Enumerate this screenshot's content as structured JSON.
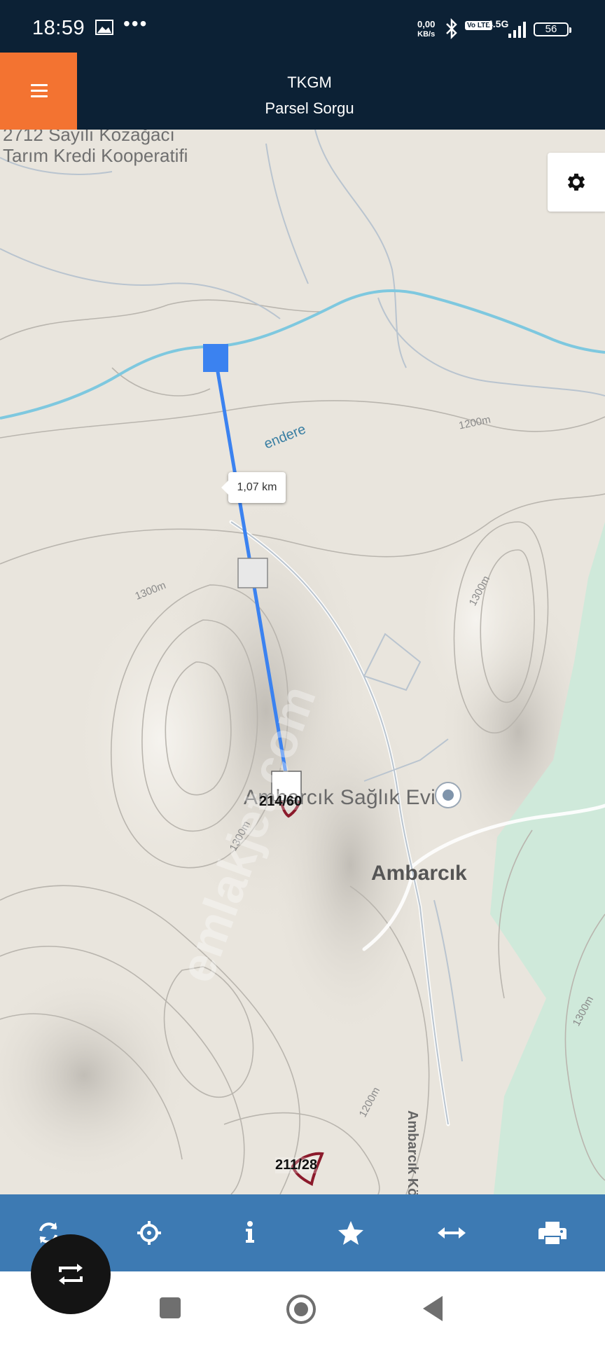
{
  "status_bar": {
    "time": "18:59",
    "dots": "•••",
    "net_speed_value": "0,00",
    "net_speed_unit": "KB/s",
    "volte": "Vo LTE",
    "network": "4.5G",
    "battery": "56"
  },
  "header": {
    "title": "TKGM",
    "subtitle": "Parsel Sorgu",
    "menu_icon": "hamburger-icon"
  },
  "map": {
    "place_labels": {
      "cooperative_line1": "2712 Sayılı Kozağacı",
      "cooperative_line2": "Tarım Kredi Kooperatifi",
      "stream": "endere",
      "health_post": "Ambarcık Sağlık Evi",
      "village": "Ambarcık",
      "road": "Ambarcık Köyü Yolu"
    },
    "contour_labels": [
      "1200m",
      "1300m",
      "1300m",
      "1300m",
      "1200m",
      "1300m"
    ],
    "measurement": {
      "distance": "1,07 km"
    },
    "parcels": [
      "214/60",
      "211/28"
    ],
    "watermark": "emlakjet.com",
    "settings_icon": "gear-icon",
    "colors": {
      "measure_line": "#3b82f0",
      "parcel_outline": "#8b1a2b",
      "water": "#7ec8df"
    }
  },
  "toolbar": {
    "buttons": [
      {
        "icon": "refresh-icon"
      },
      {
        "icon": "crosshair-icon"
      },
      {
        "icon": "info-icon"
      },
      {
        "icon": "star-icon"
      },
      {
        "icon": "measure-icon"
      },
      {
        "icon": "print-icon"
      }
    ],
    "color": "#3d7ab3"
  },
  "floating_button": {
    "icon": "swap-icon"
  },
  "nav_bar": {
    "buttons": [
      "recents-button",
      "home-button",
      "back-button"
    ]
  }
}
